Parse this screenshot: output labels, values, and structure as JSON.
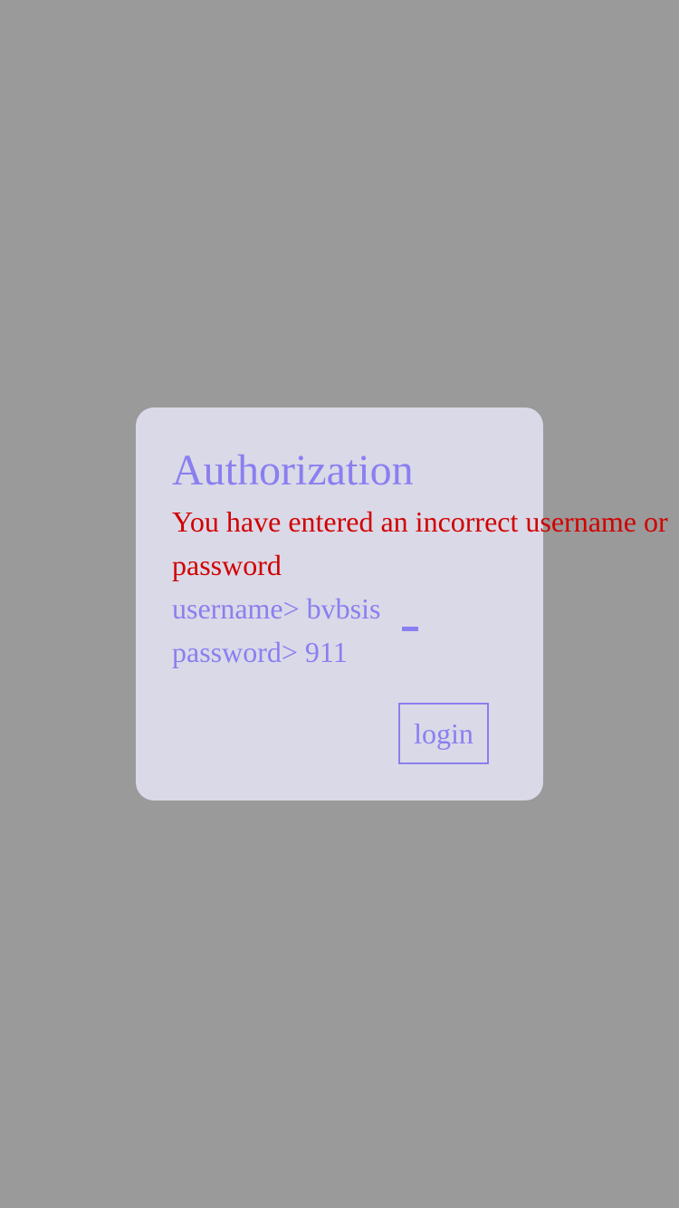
{
  "dialog": {
    "title": "Authorization",
    "error_message": "You have entered an incorrect username or password",
    "username_prompt": "username> ",
    "username_value": "bvbsis",
    "password_prompt": "password> ",
    "password_value": "911",
    "login_label": "login"
  },
  "colors": {
    "background": "#9a9a9a",
    "dialog": "#dad9e7",
    "accent": "#8a7ff0",
    "error": "#d10000"
  }
}
